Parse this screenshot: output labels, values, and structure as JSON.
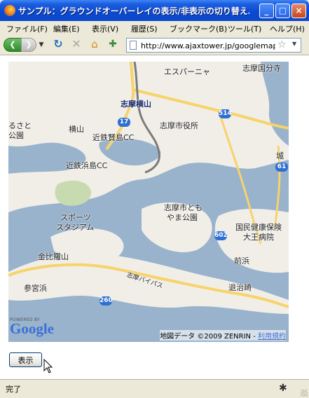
{
  "window": {
    "title": "サンプル：グラウンドオーバーレイの表示/非表示の切り替え…",
    "controls": {
      "minimize": "_",
      "maximize": "□",
      "close": "×"
    }
  },
  "menu": {
    "items": [
      "ファイル(F)",
      "編集(E)",
      "表示(V)",
      "履歴(S)",
      "ブックマーク(B)",
      "ツール(T)",
      "ヘルプ(H)"
    ]
  },
  "toolbar": {
    "address_value": "http://www.ajaxtower.jp/googlemaps/"
  },
  "map": {
    "labels": {
      "place1": "エスパーニャ",
      "place2": "志摩国分寺",
      "place3": "志摩横山",
      "place4": "志摩市役所",
      "place5": "るさと",
      "place6": "公園",
      "place7": "横山",
      "place8": "近鉄賢島CC",
      "place9": "近鉄浜島CC",
      "place10": "城",
      "place11": "志摩市とも",
      "place12": "やま公園",
      "place13": "スポーツ",
      "place14": "スタジアム",
      "place15": "国民健康保険",
      "place16": "大王病院",
      "place17": "前浜",
      "place18": "金比羅山",
      "place19": "参宮浜",
      "place20": "退治崎",
      "road": "志摩バイパス"
    },
    "route_shields": [
      "17",
      "514",
      "61",
      "602",
      "260"
    ],
    "google_powered": "POWERED BY",
    "google_word": "Google",
    "attribution": "地図データ ©2009 ZENRIN - ",
    "terms_link": "利用規約"
  },
  "page": {
    "show_button": "表示"
  },
  "status": {
    "text": "完了"
  },
  "colors": {
    "water": "#99b3cc",
    "land": "#f1eee8",
    "road_major": "#f7d36a",
    "road_gray": "#7b7b7b",
    "park": "#c8dbb0"
  }
}
